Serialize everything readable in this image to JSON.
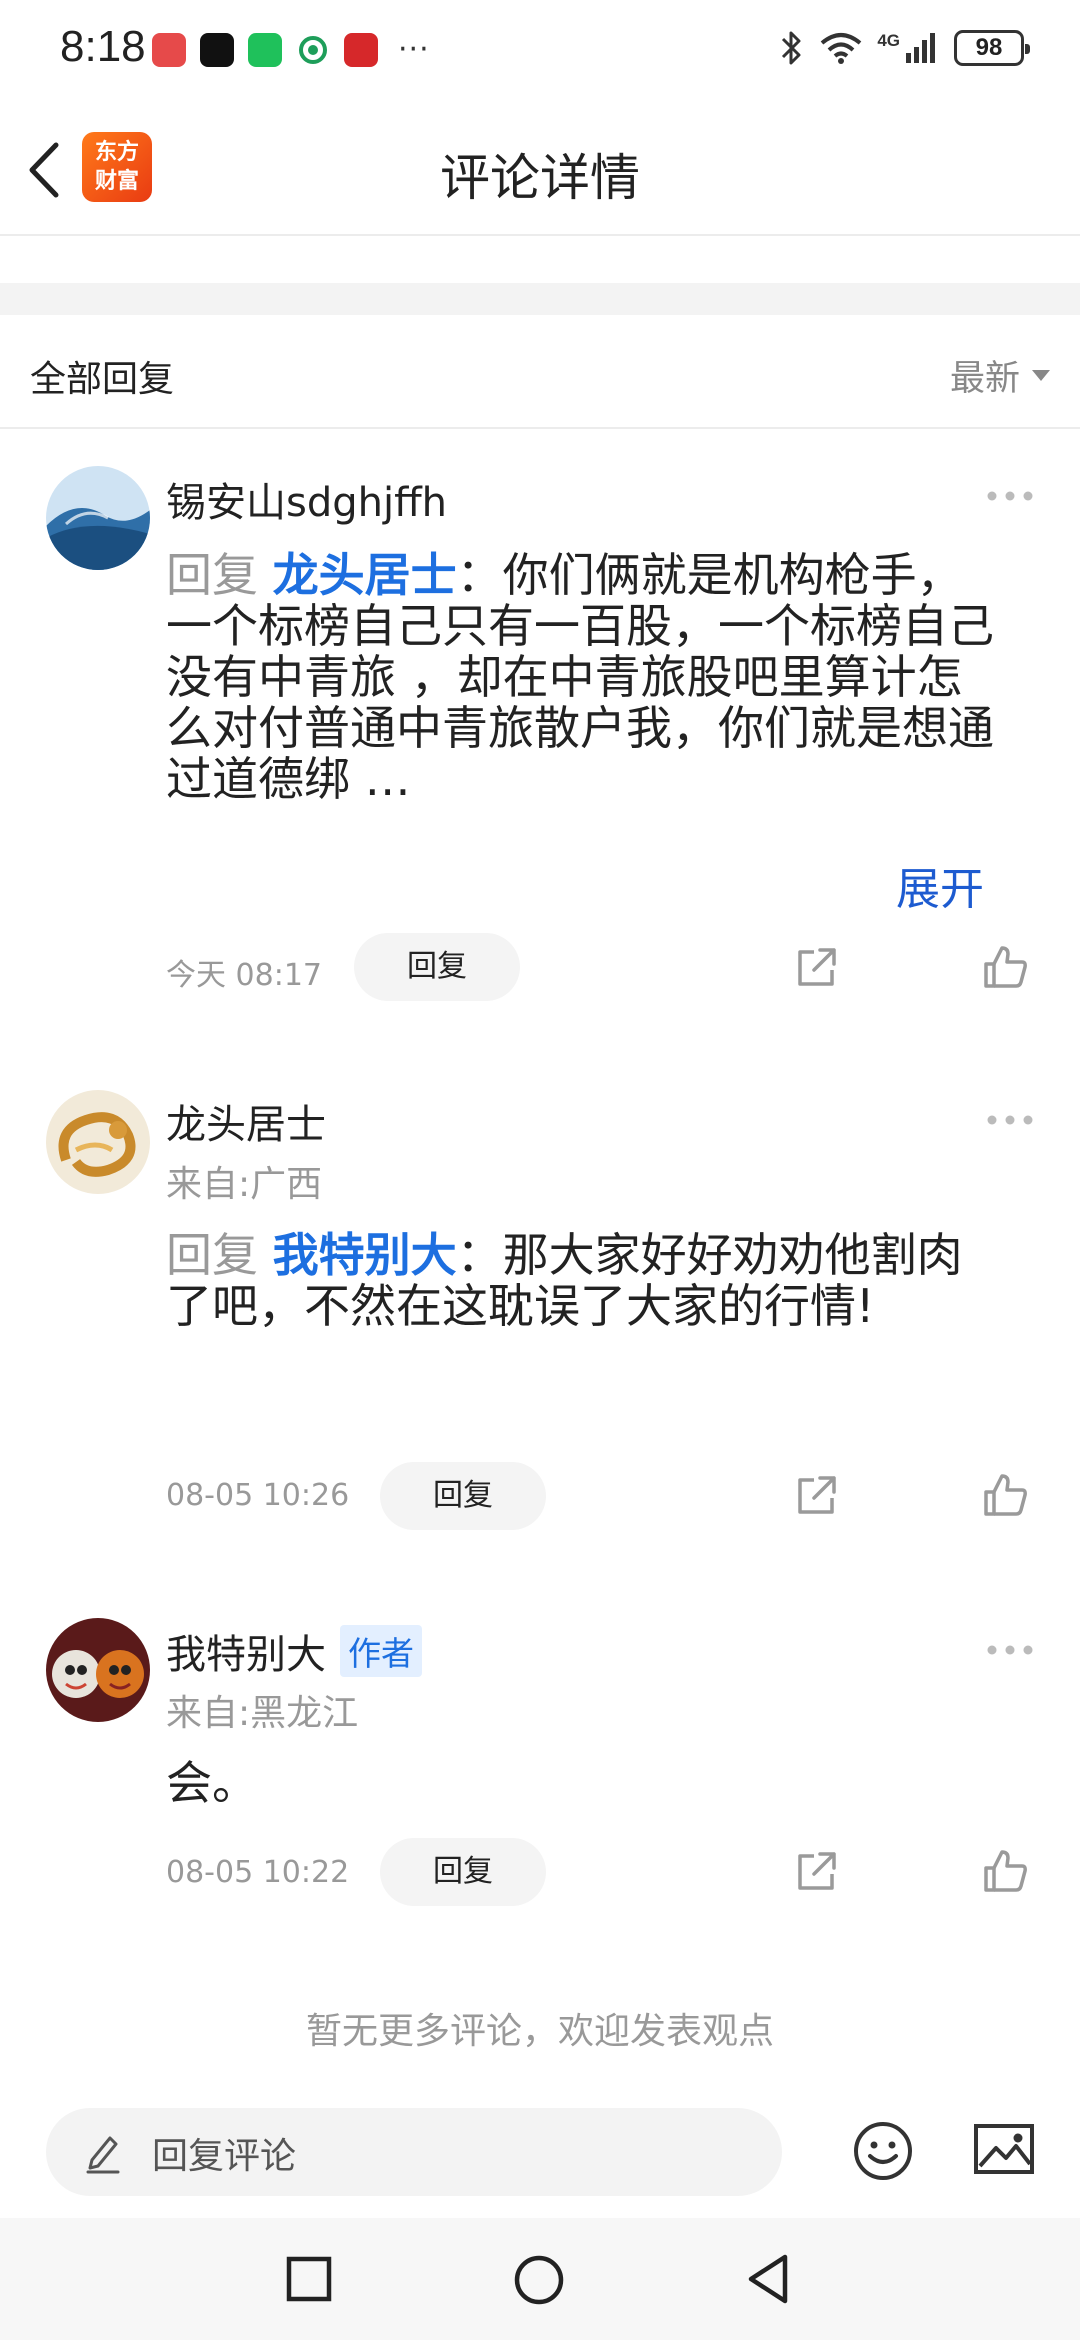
{
  "status_bar": {
    "time": "8:18",
    "more": "···",
    "network": "4G",
    "battery": "98",
    "app_colors": [
      "#e64a4a",
      "#111111",
      "#1fc15b",
      "#ffffff",
      "#d6282a"
    ]
  },
  "header": {
    "title": "评论详情",
    "logo_text_line1": "东方",
    "logo_text_line2": "财富"
  },
  "section": {
    "title": "全部回复",
    "sort_label": "最新"
  },
  "comments": [
    {
      "username": "锡安山sdghjffh",
      "location": "",
      "reply_prefix": "回复",
      "reply_to": "龙头居士",
      "text": "你们俩就是机构枪手，一个标榜自己只有一百股，一个标榜自己没有中青旅 ，却在中青旅股吧里算计怎么对付普通中青旅散户我，你们就是想通过道德绑 …",
      "expand_label": "展开",
      "time": "今天 08:17",
      "reply_button": "回复"
    },
    {
      "username": "龙头居士",
      "location": "来自:广西",
      "reply_prefix": "回复",
      "reply_to": "我特别大",
      "text": "那大家好好劝劝他割肉了吧，不然在这耽误了大家的行情!",
      "time": "08-05 10:26",
      "reply_button": "回复"
    },
    {
      "username": "我特别大",
      "badge": "作者",
      "location": "来自:黑龙江",
      "text": "会。",
      "time": "08-05 10:22",
      "reply_button": "回复"
    }
  ],
  "footer_note": "暂无更多评论，欢迎发表观点",
  "input": {
    "placeholder": "回复评论"
  },
  "colors": {
    "accent_blue": "#1d6fe0",
    "logo_orange": "#f2601a",
    "muted_text": "#999999"
  },
  "icons": [
    "back-icon",
    "more-dots-icon",
    "share-icon",
    "like-icon",
    "pencil-icon",
    "emoji-icon",
    "image-icon",
    "nav-square-icon",
    "nav-circle-icon",
    "nav-back-icon"
  ]
}
